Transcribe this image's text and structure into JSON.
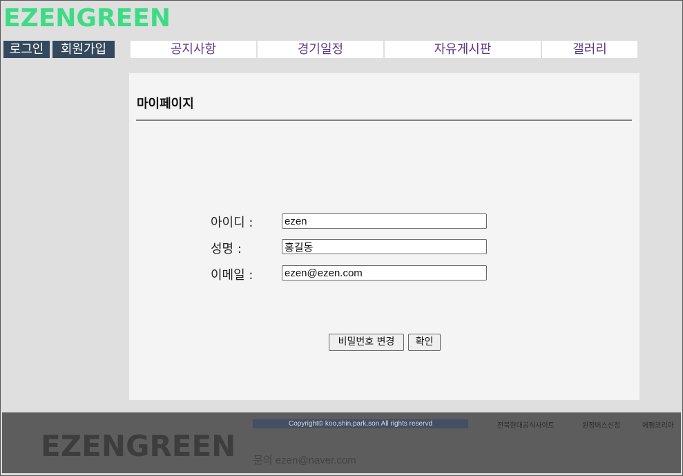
{
  "header": {
    "logo": "EZENGREEN",
    "login_label": "로그인",
    "signup_label": "회원가입"
  },
  "nav": {
    "items": [
      {
        "label": "공지사항"
      },
      {
        "label": "경기일정"
      },
      {
        "label": "자유게시판"
      },
      {
        "label": "갤러리"
      }
    ]
  },
  "mypage": {
    "title": "마이페이지",
    "fields": [
      {
        "label": "아이디 :",
        "value": "ezen"
      },
      {
        "label": "성명 :",
        "value": "홍길동"
      },
      {
        "label": "이메일 :",
        "value": "ezen@ezen.com"
      }
    ],
    "change_password_label": "비밀번호 변경",
    "confirm_label": "확인"
  },
  "footer": {
    "logo": "EZENGREEN",
    "copyright": "Copyright© koo,shin,park,son All rights reservd",
    "links": [
      {
        "label": "전북현대공식사이트"
      },
      {
        "label": "원정버스신청"
      },
      {
        "label": "에펨코리아"
      }
    ],
    "contact": "문의 ezen@naver.com"
  },
  "colors": {
    "logo_green": "#3ddc84",
    "auth_button_bg": "#34495e",
    "nav_text": "#5b3a8a",
    "page_bg": "#dfdfdf",
    "footer_bg": "#5d5d5d"
  }
}
